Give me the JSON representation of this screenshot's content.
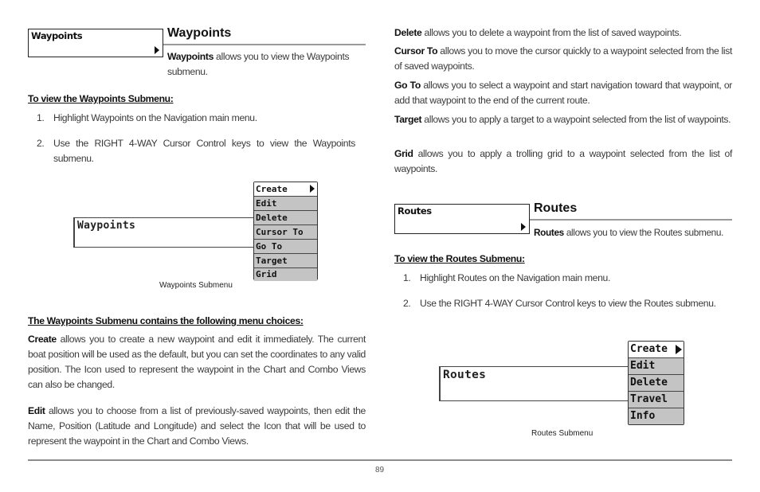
{
  "waypoints_section": {
    "tag_label": "Waypoints",
    "title": "Waypoints",
    "intro_bold": "Waypoints",
    "intro_text": " allows you to view the Waypoints submenu.",
    "howto_heading": "To view the Waypoints Submenu:",
    "steps": [
      {
        "num": "1.",
        "text": "Highlight Waypoints on the Navigation main menu."
      },
      {
        "num": "2.",
        "text": "Use the RIGHT 4-WAY Cursor Control keys to view the Waypoints submenu."
      }
    ],
    "screen": {
      "panel_label": "Waypoints",
      "menu_items": [
        "Create",
        "Edit",
        "Delete",
        "Cursor To",
        "Go To",
        "Target",
        "Grid"
      ],
      "selected_index": 0,
      "caption": "Waypoints Submenu"
    },
    "choices_heading": "The Waypoints Submenu contains the following menu choices:",
    "choices": [
      {
        "term": "Create",
        "text": " allows you to create a new waypoint and edit it immediately. The current boat position will be used as the default, but you can set the coordinates to any valid position. The Icon used to represent the waypoint in the Chart and Combo Views can also be changed."
      },
      {
        "term": "Edit",
        "text": " allows you to choose from a list of previously-saved waypoints, then edit the Name, Position (Latitude and Longitude) and select the Icon that will be used to represent the waypoint in the Chart and Combo Views."
      },
      {
        "term": "Delete",
        "text": " allows you to delete a waypoint from the list of saved waypoints."
      },
      {
        "term": "Cursor To",
        "text": " allows you to move the cursor quickly to a waypoint selected from the list of saved waypoints."
      },
      {
        "term": "Go To",
        "text": " allows you to select a waypoint and start navigation toward that waypoint, or add that waypoint to the end of the current route."
      },
      {
        "term": "Target",
        "text": " allows you to apply a target to a waypoint selected from the list of waypoints."
      },
      {
        "term": "Grid",
        "text": " allows you to apply a trolling grid to a waypoint selected from the list of waypoints."
      }
    ]
  },
  "routes_section": {
    "tag_label": "Routes",
    "title": "Routes",
    "intro_bold": "Routes",
    "intro_text": " allows you to view the Routes submenu.",
    "howto_heading": "To view the Routes Submenu:",
    "steps": [
      {
        "num": "1.",
        "text": "Highlight Routes on the Navigation main menu."
      },
      {
        "num": "2.",
        "text": "Use the RIGHT 4-WAY Cursor Control keys to view the Routes submenu."
      }
    ],
    "screen": {
      "panel_label": "Routes",
      "menu_items": [
        "Create",
        "Edit",
        "Delete",
        "Travel",
        "Info"
      ],
      "selected_index": 0,
      "caption": "Routes Submenu"
    }
  },
  "footer": {
    "page_number": "89"
  }
}
